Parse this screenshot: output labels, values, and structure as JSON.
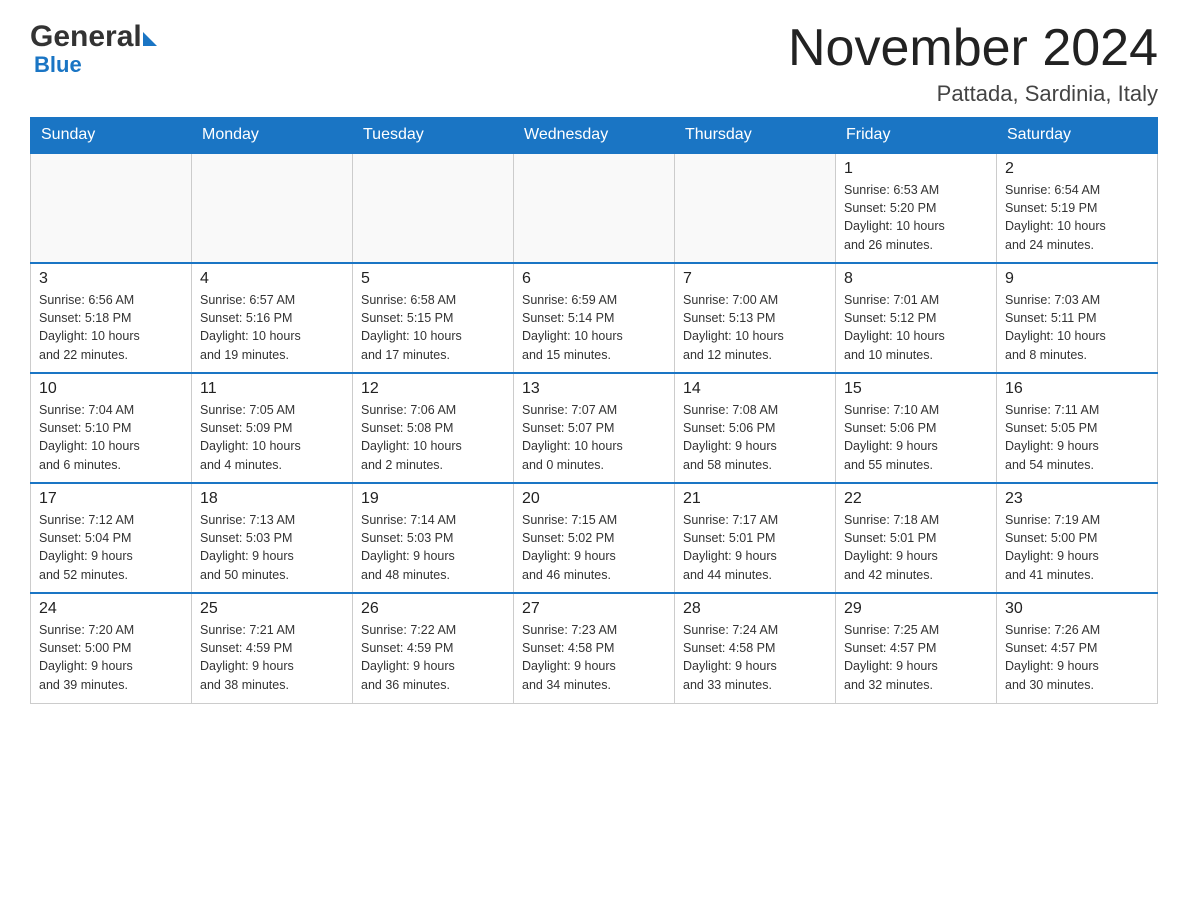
{
  "logo": {
    "general": "General",
    "blue": "Blue"
  },
  "title": "November 2024",
  "subtitle": "Pattada, Sardinia, Italy",
  "weekdays": [
    "Sunday",
    "Monday",
    "Tuesday",
    "Wednesday",
    "Thursday",
    "Friday",
    "Saturday"
  ],
  "weeks": [
    [
      {
        "day": "",
        "info": ""
      },
      {
        "day": "",
        "info": ""
      },
      {
        "day": "",
        "info": ""
      },
      {
        "day": "",
        "info": ""
      },
      {
        "day": "",
        "info": ""
      },
      {
        "day": "1",
        "info": "Sunrise: 6:53 AM\nSunset: 5:20 PM\nDaylight: 10 hours\nand 26 minutes."
      },
      {
        "day": "2",
        "info": "Sunrise: 6:54 AM\nSunset: 5:19 PM\nDaylight: 10 hours\nand 24 minutes."
      }
    ],
    [
      {
        "day": "3",
        "info": "Sunrise: 6:56 AM\nSunset: 5:18 PM\nDaylight: 10 hours\nand 22 minutes."
      },
      {
        "day": "4",
        "info": "Sunrise: 6:57 AM\nSunset: 5:16 PM\nDaylight: 10 hours\nand 19 minutes."
      },
      {
        "day": "5",
        "info": "Sunrise: 6:58 AM\nSunset: 5:15 PM\nDaylight: 10 hours\nand 17 minutes."
      },
      {
        "day": "6",
        "info": "Sunrise: 6:59 AM\nSunset: 5:14 PM\nDaylight: 10 hours\nand 15 minutes."
      },
      {
        "day": "7",
        "info": "Sunrise: 7:00 AM\nSunset: 5:13 PM\nDaylight: 10 hours\nand 12 minutes."
      },
      {
        "day": "8",
        "info": "Sunrise: 7:01 AM\nSunset: 5:12 PM\nDaylight: 10 hours\nand 10 minutes."
      },
      {
        "day": "9",
        "info": "Sunrise: 7:03 AM\nSunset: 5:11 PM\nDaylight: 10 hours\nand 8 minutes."
      }
    ],
    [
      {
        "day": "10",
        "info": "Sunrise: 7:04 AM\nSunset: 5:10 PM\nDaylight: 10 hours\nand 6 minutes."
      },
      {
        "day": "11",
        "info": "Sunrise: 7:05 AM\nSunset: 5:09 PM\nDaylight: 10 hours\nand 4 minutes."
      },
      {
        "day": "12",
        "info": "Sunrise: 7:06 AM\nSunset: 5:08 PM\nDaylight: 10 hours\nand 2 minutes."
      },
      {
        "day": "13",
        "info": "Sunrise: 7:07 AM\nSunset: 5:07 PM\nDaylight: 10 hours\nand 0 minutes."
      },
      {
        "day": "14",
        "info": "Sunrise: 7:08 AM\nSunset: 5:06 PM\nDaylight: 9 hours\nand 58 minutes."
      },
      {
        "day": "15",
        "info": "Sunrise: 7:10 AM\nSunset: 5:06 PM\nDaylight: 9 hours\nand 55 minutes."
      },
      {
        "day": "16",
        "info": "Sunrise: 7:11 AM\nSunset: 5:05 PM\nDaylight: 9 hours\nand 54 minutes."
      }
    ],
    [
      {
        "day": "17",
        "info": "Sunrise: 7:12 AM\nSunset: 5:04 PM\nDaylight: 9 hours\nand 52 minutes."
      },
      {
        "day": "18",
        "info": "Sunrise: 7:13 AM\nSunset: 5:03 PM\nDaylight: 9 hours\nand 50 minutes."
      },
      {
        "day": "19",
        "info": "Sunrise: 7:14 AM\nSunset: 5:03 PM\nDaylight: 9 hours\nand 48 minutes."
      },
      {
        "day": "20",
        "info": "Sunrise: 7:15 AM\nSunset: 5:02 PM\nDaylight: 9 hours\nand 46 minutes."
      },
      {
        "day": "21",
        "info": "Sunrise: 7:17 AM\nSunset: 5:01 PM\nDaylight: 9 hours\nand 44 minutes."
      },
      {
        "day": "22",
        "info": "Sunrise: 7:18 AM\nSunset: 5:01 PM\nDaylight: 9 hours\nand 42 minutes."
      },
      {
        "day": "23",
        "info": "Sunrise: 7:19 AM\nSunset: 5:00 PM\nDaylight: 9 hours\nand 41 minutes."
      }
    ],
    [
      {
        "day": "24",
        "info": "Sunrise: 7:20 AM\nSunset: 5:00 PM\nDaylight: 9 hours\nand 39 minutes."
      },
      {
        "day": "25",
        "info": "Sunrise: 7:21 AM\nSunset: 4:59 PM\nDaylight: 9 hours\nand 38 minutes."
      },
      {
        "day": "26",
        "info": "Sunrise: 7:22 AM\nSunset: 4:59 PM\nDaylight: 9 hours\nand 36 minutes."
      },
      {
        "day": "27",
        "info": "Sunrise: 7:23 AM\nSunset: 4:58 PM\nDaylight: 9 hours\nand 34 minutes."
      },
      {
        "day": "28",
        "info": "Sunrise: 7:24 AM\nSunset: 4:58 PM\nDaylight: 9 hours\nand 33 minutes."
      },
      {
        "day": "29",
        "info": "Sunrise: 7:25 AM\nSunset: 4:57 PM\nDaylight: 9 hours\nand 32 minutes."
      },
      {
        "day": "30",
        "info": "Sunrise: 7:26 AM\nSunset: 4:57 PM\nDaylight: 9 hours\nand 30 minutes."
      }
    ]
  ]
}
